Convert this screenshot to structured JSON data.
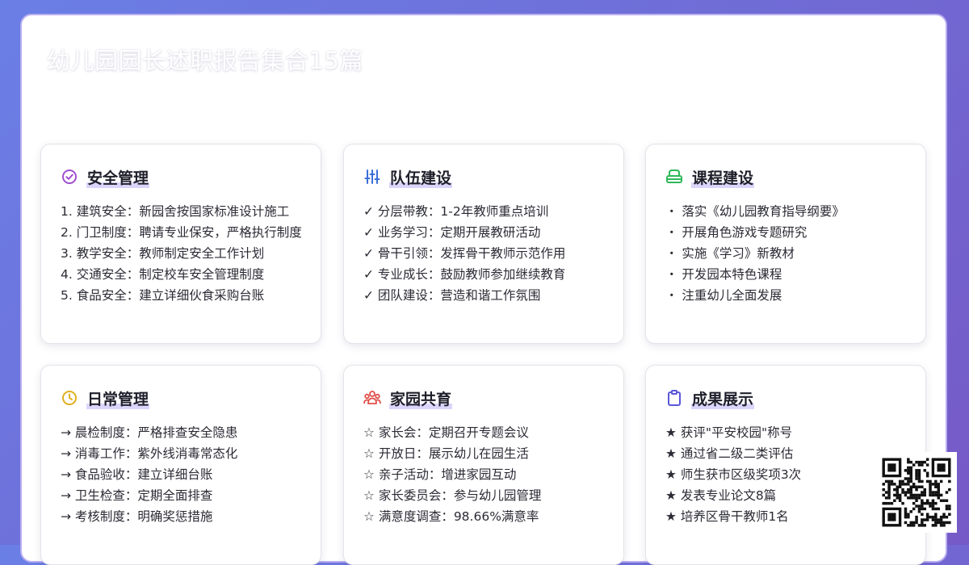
{
  "page": {
    "title": "幼儿园园长述职报告集合15篇"
  },
  "cards": [
    {
      "id": "safety",
      "icon": "check-circle-icon",
      "color": "#a04fd0",
      "title": "安全管理",
      "items": [
        "1. 建筑安全：新园舍按国家标准设计施工",
        "2. 门卫制度：聘请专业保安，严格执行制度",
        "3. 教学安全：教师制定安全工作计划",
        "4. 交通安全：制定校车安全管理制度",
        "5. 食品安全：建立详细伙食采购台账"
      ]
    },
    {
      "id": "team",
      "icon": "sliders-icon",
      "color": "#3c6fd8",
      "title": "队伍建设",
      "items": [
        "✓ 分层带教：1-2年教师重点培训",
        "✓ 业务学习：定期开展教研活动",
        "✓ 骨干引领：发挥骨干教师示范作用",
        "✓ 专业成长：鼓励教师参加继续教育",
        "✓ 团队建设：营造和谐工作氛围"
      ]
    },
    {
      "id": "curriculum",
      "icon": "layers-icon",
      "color": "#2fb85a",
      "title": "课程建设",
      "items": [
        "・ 落实《幼儿园教育指导纲要》",
        "・ 开展角色游戏专题研究",
        "・ 实施《学习》新教材",
        "・ 开发园本特色课程",
        "・ 注重幼儿全面发展"
      ]
    },
    {
      "id": "daily",
      "icon": "clock-icon",
      "color": "#e0b020",
      "title": "日常管理",
      "items": [
        "→ 晨检制度：严格排查安全隐患",
        "→ 消毒工作：紫外线消毒常态化",
        "→ 食品验收：建立详细台账",
        "→ 卫生检查：定期全面排查",
        "→ 考核制度：明确奖惩措施"
      ]
    },
    {
      "id": "homeschool",
      "icon": "people-icon",
      "color": "#e0504a",
      "title": "家园共育",
      "items": [
        "☆ 家长会：定期召开专题会议",
        "☆ 开放日：展示幼儿在园生活",
        "☆ 亲子活动：增进家园互动",
        "☆ 家长委员会：参与幼儿园管理",
        "☆ 满意度调查：98.66%满意率"
      ]
    },
    {
      "id": "results",
      "icon": "clipboard-icon",
      "color": "#5a58d8",
      "title": "成果展示",
      "items": [
        "★ 获评\"平安校园\"称号",
        "★ 通过省二级二类评估",
        "★ 师生获市区级奖项3次",
        "★ 发表专业论文8篇",
        "★ 培养区骨干教师1名"
      ]
    }
  ],
  "qr": {
    "icon": "qr-code-icon"
  }
}
